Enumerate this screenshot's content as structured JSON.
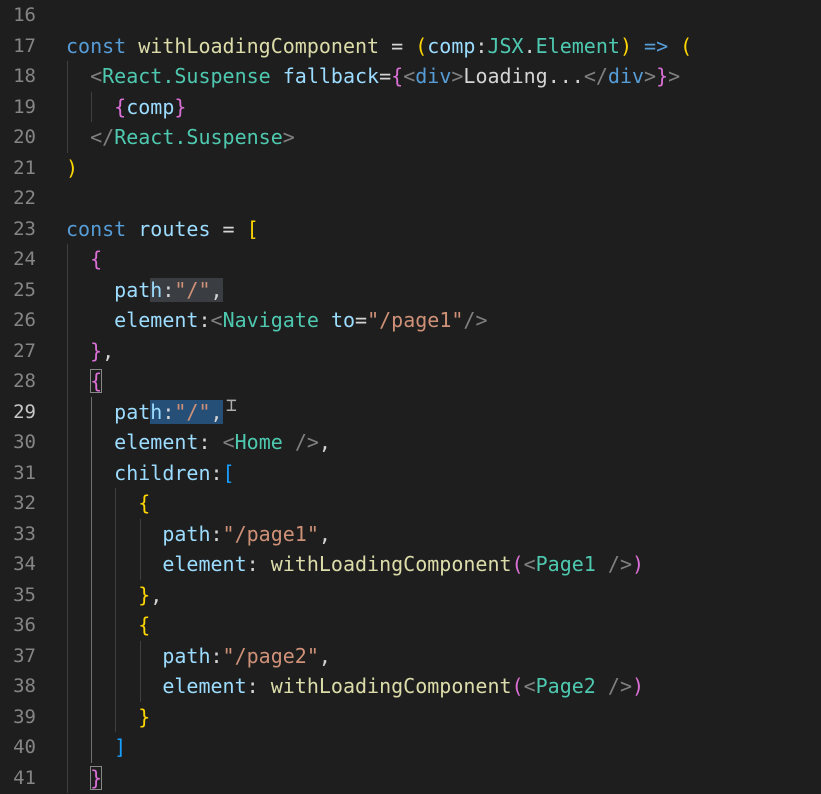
{
  "editor": {
    "active_line": "29",
    "colors": {
      "background": "#1e1e1e",
      "keyword": "#569cd6",
      "variable": "#9cdcfe",
      "function": "#dcdcaa",
      "string": "#ce9178",
      "type": "#4ec9b0",
      "tag_bracket": "#808080",
      "bracket_gold": "#ffd700",
      "bracket_pink": "#da70d6",
      "bracket_blue": "#179fff",
      "line_number": "#858585",
      "selection": "#264f78"
    },
    "lines": [
      {
        "number": "16",
        "tokens": []
      },
      {
        "number": "17",
        "tokens": [
          {
            "text": "const ",
            "color": "#569cd6"
          },
          {
            "text": "withLoadingComponent",
            "color": "#dcdcaa"
          },
          {
            "text": " = ",
            "color": "#d4d4d4"
          },
          {
            "text": "(",
            "color": "#ffd700"
          },
          {
            "text": "comp",
            "color": "#9cdcfe"
          },
          {
            "text": ":",
            "color": "#d4d4d4"
          },
          {
            "text": "JSX",
            "color": "#4ec9b0"
          },
          {
            "text": ".",
            "color": "#d4d4d4"
          },
          {
            "text": "Element",
            "color": "#4ec9b0"
          },
          {
            "text": ")",
            "color": "#ffd700"
          },
          {
            "text": " ",
            "color": "#d4d4d4"
          },
          {
            "text": "=>",
            "color": "#569cd6"
          },
          {
            "text": " ",
            "color": "#d4d4d4"
          },
          {
            "text": "(",
            "color": "#ffd700"
          }
        ]
      },
      {
        "number": "18",
        "tokens": [
          {
            "text": "  ",
            "color": "#d4d4d4"
          },
          {
            "text": "<",
            "color": "#808080"
          },
          {
            "text": "React.Suspense",
            "color": "#4ec9b0"
          },
          {
            "text": " ",
            "color": "#d4d4d4"
          },
          {
            "text": "fallback",
            "color": "#9cdcfe"
          },
          {
            "text": "=",
            "color": "#d4d4d4"
          },
          {
            "text": "{",
            "color": "#da70d6"
          },
          {
            "text": "<",
            "color": "#808080"
          },
          {
            "text": "div",
            "color": "#569cd6"
          },
          {
            "text": ">",
            "color": "#808080"
          },
          {
            "text": "Loading...",
            "color": "#d4d4d4"
          },
          {
            "text": "</",
            "color": "#808080"
          },
          {
            "text": "div",
            "color": "#569cd6"
          },
          {
            "text": ">",
            "color": "#808080"
          },
          {
            "text": "}",
            "color": "#da70d6"
          },
          {
            "text": ">",
            "color": "#808080"
          }
        ]
      },
      {
        "number": "19",
        "tokens": [
          {
            "text": "    ",
            "color": "#d4d4d4"
          },
          {
            "text": "{",
            "color": "#da70d6"
          },
          {
            "text": "comp",
            "color": "#9cdcfe"
          },
          {
            "text": "}",
            "color": "#da70d6"
          }
        ]
      },
      {
        "number": "20",
        "tokens": [
          {
            "text": "  ",
            "color": "#d4d4d4"
          },
          {
            "text": "</",
            "color": "#808080"
          },
          {
            "text": "React.Suspense",
            "color": "#4ec9b0"
          },
          {
            "text": ">",
            "color": "#808080"
          }
        ]
      },
      {
        "number": "21",
        "tokens": [
          {
            "text": ")",
            "color": "#ffd700"
          }
        ]
      },
      {
        "number": "22",
        "tokens": []
      },
      {
        "number": "23",
        "tokens": [
          {
            "text": "const ",
            "color": "#569cd6"
          },
          {
            "text": "routes",
            "color": "#9cdcfe"
          },
          {
            "text": " = ",
            "color": "#d4d4d4"
          },
          {
            "text": "[",
            "color": "#ffd700"
          }
        ]
      },
      {
        "number": "24",
        "tokens": [
          {
            "text": "  ",
            "color": "#d4d4d4"
          },
          {
            "text": "{",
            "color": "#da70d6"
          }
        ]
      },
      {
        "number": "25",
        "tokens": [
          {
            "text": "    ",
            "color": "#d4d4d4"
          },
          {
            "text": "pat",
            "color": "#9cdcfe"
          },
          {
            "text": "h:\"/\",",
            "color": "#9cdcfe",
            "mark": "hl",
            "subtokens": [
              {
                "text": "h",
                "color": "#9cdcfe"
              },
              {
                "text": ":",
                "color": "#d4d4d4"
              },
              {
                "text": "\"/\"",
                "color": "#ce9178"
              },
              {
                "text": ",",
                "color": "#d4d4d4"
              }
            ]
          }
        ]
      },
      {
        "number": "26",
        "tokens": [
          {
            "text": "    ",
            "color": "#d4d4d4"
          },
          {
            "text": "element",
            "color": "#9cdcfe"
          },
          {
            "text": ":",
            "color": "#d4d4d4"
          },
          {
            "text": "<",
            "color": "#808080"
          },
          {
            "text": "Navigate",
            "color": "#4ec9b0"
          },
          {
            "text": " ",
            "color": "#d4d4d4"
          },
          {
            "text": "to",
            "color": "#9cdcfe"
          },
          {
            "text": "=",
            "color": "#d4d4d4"
          },
          {
            "text": "\"/page1\"",
            "color": "#ce9178"
          },
          {
            "text": "/>",
            "color": "#808080"
          }
        ]
      },
      {
        "number": "27",
        "tokens": [
          {
            "text": "  ",
            "color": "#d4d4d4"
          },
          {
            "text": "}",
            "color": "#da70d6"
          },
          {
            "text": ",",
            "color": "#d4d4d4"
          }
        ]
      },
      {
        "number": "28",
        "tokens": [
          {
            "text": "  ",
            "color": "#d4d4d4"
          },
          {
            "text": "{",
            "color": "#da70d6",
            "mark": "bm"
          }
        ]
      },
      {
        "number": "29",
        "tokens": [
          {
            "text": "    ",
            "color": "#d4d4d4"
          },
          {
            "text": "pat",
            "color": "#9cdcfe"
          },
          {
            "text": "h:\"/\",",
            "color": "#9cdcfe",
            "mark": "sel",
            "subtokens": [
              {
                "text": "h",
                "color": "#9cdcfe"
              },
              {
                "text": ":",
                "color": "#d4d4d4"
              },
              {
                "text": "\"/\"",
                "color": "#ce9178"
              },
              {
                "text": ",",
                "color": "#d4d4d4"
              }
            ]
          }
        ]
      },
      {
        "number": "30",
        "tokens": [
          {
            "text": "    ",
            "color": "#d4d4d4"
          },
          {
            "text": "element",
            "color": "#9cdcfe"
          },
          {
            "text": ": ",
            "color": "#d4d4d4"
          },
          {
            "text": "<",
            "color": "#808080"
          },
          {
            "text": "Home",
            "color": "#4ec9b0"
          },
          {
            "text": " />",
            "color": "#808080"
          },
          {
            "text": ",",
            "color": "#d4d4d4"
          }
        ]
      },
      {
        "number": "31",
        "tokens": [
          {
            "text": "    ",
            "color": "#d4d4d4"
          },
          {
            "text": "children",
            "color": "#9cdcfe"
          },
          {
            "text": ":",
            "color": "#d4d4d4"
          },
          {
            "text": "[",
            "color": "#179fff"
          }
        ]
      },
      {
        "number": "32",
        "tokens": [
          {
            "text": "      ",
            "color": "#d4d4d4"
          },
          {
            "text": "{",
            "color": "#ffd700"
          }
        ]
      },
      {
        "number": "33",
        "tokens": [
          {
            "text": "        ",
            "color": "#d4d4d4"
          },
          {
            "text": "path",
            "color": "#9cdcfe"
          },
          {
            "text": ":",
            "color": "#d4d4d4"
          },
          {
            "text": "\"/page1\"",
            "color": "#ce9178"
          },
          {
            "text": ",",
            "color": "#d4d4d4"
          }
        ]
      },
      {
        "number": "34",
        "tokens": [
          {
            "text": "        ",
            "color": "#d4d4d4"
          },
          {
            "text": "element",
            "color": "#9cdcfe"
          },
          {
            "text": ": ",
            "color": "#d4d4d4"
          },
          {
            "text": "withLoadingComponent",
            "color": "#dcdcaa"
          },
          {
            "text": "(",
            "color": "#da70d6"
          },
          {
            "text": "<",
            "color": "#808080"
          },
          {
            "text": "Page1",
            "color": "#4ec9b0"
          },
          {
            "text": " />",
            "color": "#808080"
          },
          {
            "text": ")",
            "color": "#da70d6"
          }
        ]
      },
      {
        "number": "35",
        "tokens": [
          {
            "text": "      ",
            "color": "#d4d4d4"
          },
          {
            "text": "}",
            "color": "#ffd700"
          },
          {
            "text": ",",
            "color": "#d4d4d4"
          }
        ]
      },
      {
        "number": "36",
        "tokens": [
          {
            "text": "      ",
            "color": "#d4d4d4"
          },
          {
            "text": "{",
            "color": "#ffd700"
          }
        ]
      },
      {
        "number": "37",
        "tokens": [
          {
            "text": "        ",
            "color": "#d4d4d4"
          },
          {
            "text": "path",
            "color": "#9cdcfe"
          },
          {
            "text": ":",
            "color": "#d4d4d4"
          },
          {
            "text": "\"/page2\"",
            "color": "#ce9178"
          },
          {
            "text": ",",
            "color": "#d4d4d4"
          }
        ]
      },
      {
        "number": "38",
        "tokens": [
          {
            "text": "        ",
            "color": "#d4d4d4"
          },
          {
            "text": "element",
            "color": "#9cdcfe"
          },
          {
            "text": ": ",
            "color": "#d4d4d4"
          },
          {
            "text": "withLoadingComponent",
            "color": "#dcdcaa"
          },
          {
            "text": "(",
            "color": "#da70d6"
          },
          {
            "text": "<",
            "color": "#808080"
          },
          {
            "text": "Page2",
            "color": "#4ec9b0"
          },
          {
            "text": " />",
            "color": "#808080"
          },
          {
            "text": ")",
            "color": "#da70d6"
          }
        ]
      },
      {
        "number": "39",
        "tokens": [
          {
            "text": "      ",
            "color": "#d4d4d4"
          },
          {
            "text": "}",
            "color": "#ffd700"
          }
        ]
      },
      {
        "number": "40",
        "tokens": [
          {
            "text": "    ",
            "color": "#d4d4d4"
          },
          {
            "text": "]",
            "color": "#179fff"
          }
        ]
      },
      {
        "number": "41",
        "tokens": [
          {
            "text": "  ",
            "color": "#d4d4d4"
          },
          {
            "text": "}",
            "color": "#da70d6",
            "mark": "bm"
          }
        ]
      }
    ]
  }
}
